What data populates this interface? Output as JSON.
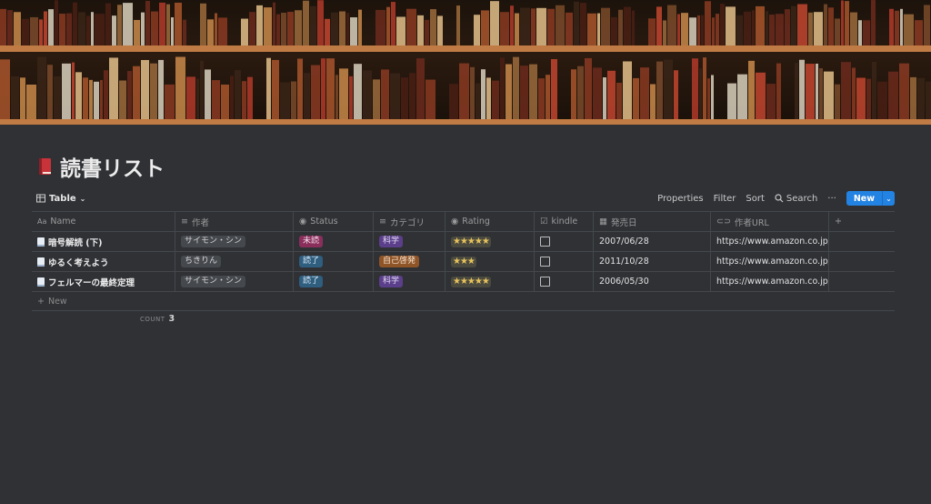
{
  "cover": {
    "description_icon": "bookshelf-cover"
  },
  "page": {
    "title": "読書リスト",
    "icon": "red-book-icon"
  },
  "toolbar": {
    "view_label": "Table",
    "properties": "Properties",
    "filter": "Filter",
    "sort": "Sort",
    "search": "Search",
    "more": "···",
    "new": "New"
  },
  "table": {
    "columns": [
      {
        "label": "Name",
        "icon": "text-icon"
      },
      {
        "label": "作者",
        "icon": "list-icon"
      },
      {
        "label": "Status",
        "icon": "status-icon"
      },
      {
        "label": "カテゴリ",
        "icon": "list-icon"
      },
      {
        "label": "Rating",
        "icon": "status-icon"
      },
      {
        "label": "kindle",
        "icon": "checkbox-icon"
      },
      {
        "label": "発売日",
        "icon": "calendar-icon"
      },
      {
        "label": "作者URL",
        "icon": "link-icon"
      },
      {
        "label": "+",
        "icon": "add-icon"
      }
    ],
    "rows": [
      {
        "name": "暗号解読 (下)",
        "author": "サイモン・シン",
        "status": "未読",
        "category": "科学",
        "rating": "★★★★★",
        "kindle": false,
        "date": "2007/06/28",
        "url": "https://www.amazon.co.jp/%"
      },
      {
        "name": "ゆるく考えよう",
        "author": "ちきりん",
        "status": "読了",
        "category": "自己啓発",
        "rating": "★★★",
        "kindle": false,
        "date": "2011/10/28",
        "url": "https://www.amazon.co.jp/%"
      },
      {
        "name": "フェルマーの最終定理",
        "author": "サイモン・シン",
        "status": "読了",
        "category": "科学",
        "rating": "★★★★★",
        "kindle": false,
        "date": "2006/05/30",
        "url": "https://www.amazon.co.jp/%"
      }
    ],
    "new_row": "New"
  },
  "footer": {
    "count_label": "COUNT",
    "count_value": "3"
  },
  "colors": {
    "background": "#2f3135",
    "accent": "#2383e2"
  }
}
